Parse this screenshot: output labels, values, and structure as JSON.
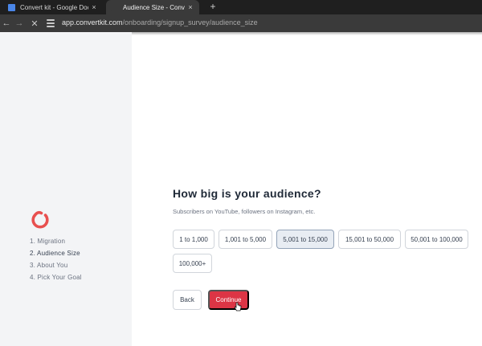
{
  "browser": {
    "tabs": [
      {
        "title": "Convert kit - Google Docs",
        "favicon": "google-docs-icon",
        "close": "×"
      },
      {
        "title": "Audience Size - ConvertKit",
        "favicon": "convertkit-favicon",
        "close": "×"
      }
    ],
    "new_tab": "+",
    "url_host": "app.convertkit.com",
    "url_path": "/onboarding/signup_survey/audience_size"
  },
  "sidebar": {
    "logo": "convertkit-logo",
    "steps": [
      {
        "label": "1. Migration"
      },
      {
        "label": "2. Audience Size"
      },
      {
        "label": "3. About You"
      },
      {
        "label": "4. Pick Your Goal"
      }
    ]
  },
  "survey": {
    "title": "How big is your audience?",
    "subtitle": "Subscribers on YouTube, followers on Instagram, etc.",
    "options": [
      {
        "label": "1 to 1,000"
      },
      {
        "label": "1,001 to 5,000"
      },
      {
        "label": "5,001 to 15,000"
      },
      {
        "label": "15,001 to 50,000"
      },
      {
        "label": "50,001 to 100,000"
      },
      {
        "label": "100,000+"
      }
    ],
    "selected_option": "5,001 to 15,000",
    "back_label": "Back",
    "continue_label": "Continue"
  },
  "colors": {
    "accent": "#dc3545",
    "selected_option_bg": "#e8edf3"
  }
}
